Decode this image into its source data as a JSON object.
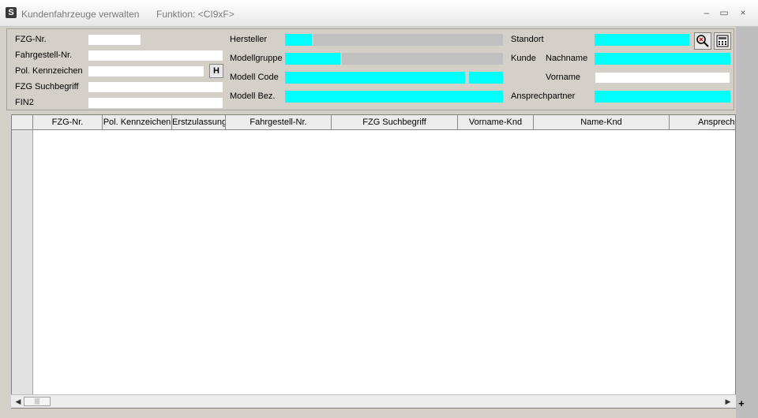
{
  "window": {
    "title": "Kundenfahrzeuge verwalten",
    "function": "Funktion: <CI9xF>",
    "app_icon": "S",
    "buttons": {
      "minimize": "–",
      "maximize": "▭",
      "close": "×"
    }
  },
  "form": {
    "fzg_nr_label": "FZG-Nr.",
    "fzg_nr_value": "",
    "fahrgestell_label": "Fahrgestell-Nr.",
    "kennzeichen_label": "Pol. Kennzeichen",
    "h_button": "H",
    "suchbegriff_label": "FZG Suchbegriff",
    "fin2_label": "FIN2",
    "hersteller_label": "Hersteller",
    "modellgruppe_label": "Modellgruppe",
    "modellcode_label": "Modell Code",
    "modellbez_label": "Modell Bez.",
    "standort_label": "Standort",
    "kunde_label": "Kunde",
    "nachname_label": "Nachname",
    "vorname_label": "Vorname",
    "ansprechpartner_label": "Ansprechpartner",
    "search_icon": "search-icon",
    "calculator_icon": "calculator-icon"
  },
  "grid": {
    "columns": [
      "FZG-Nr.",
      "Pol. Kennzeichen",
      "Erstzulassung",
      "Fahrgestell-Nr.",
      "FZG Suchbegriff",
      "Vorname-Knd",
      "Name-Knd",
      "Ansprechp"
    ],
    "rows": []
  },
  "colors": {
    "required_field": "#00ffff",
    "disabled_field": "#c0c0c0",
    "background": "#d4d0c8"
  }
}
